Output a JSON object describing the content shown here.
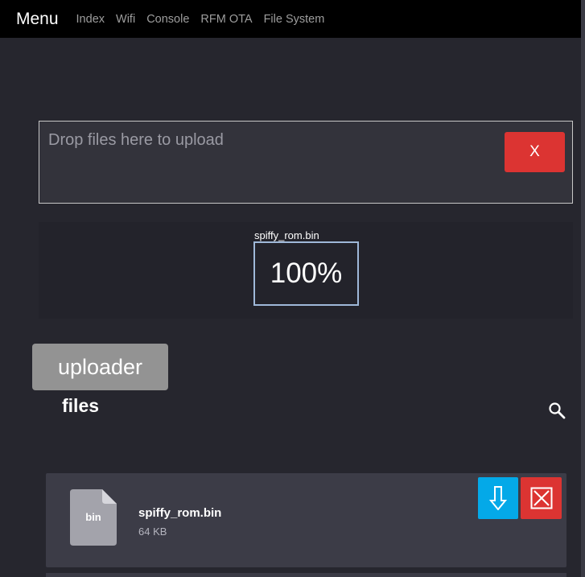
{
  "header": {
    "brand": "Menu",
    "nav": [
      "Index",
      "Wifi",
      "Console",
      "RFM OTA",
      "File System"
    ]
  },
  "dropzone": {
    "message": "Drop files here to upload",
    "close_label": "X"
  },
  "upload_progress": {
    "file_name": "spiffy_rom.bin",
    "percent_label": "100%"
  },
  "uploader_label": "uploader",
  "files_heading": "files",
  "files": [
    {
      "extension": "bin",
      "name": "spiffy_rom.bin",
      "size": "64 KB"
    }
  ],
  "colors": {
    "background": "#26262e",
    "topbar": "#000000",
    "danger": "#dc3432",
    "download": "#04a9e8",
    "uploader_button": "#939393",
    "card": "#3c3c47"
  },
  "icons": {
    "search": "search-icon",
    "download": "download-arrow-icon",
    "delete": "delete-x-icon",
    "file": "file-icon"
  }
}
